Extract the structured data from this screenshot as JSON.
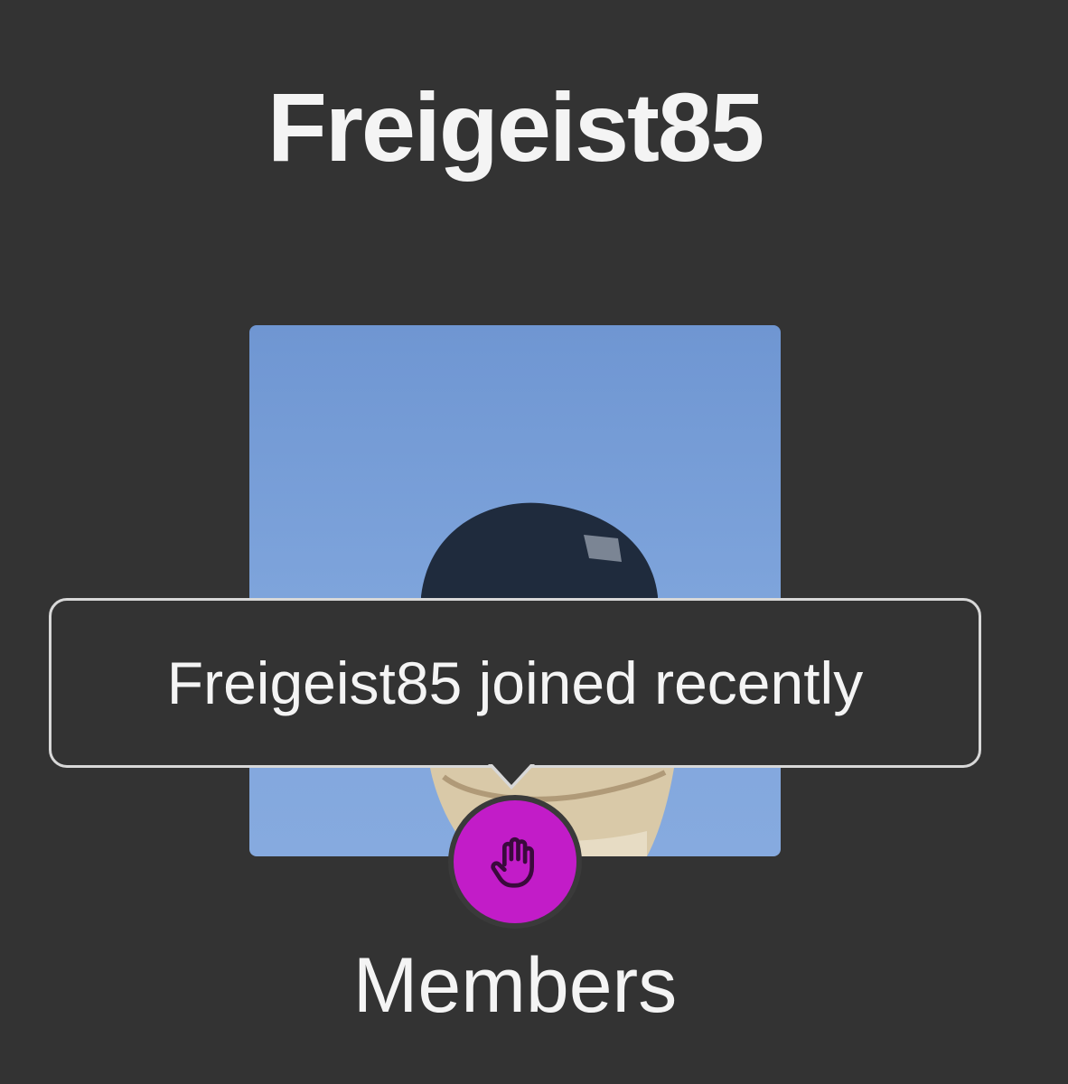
{
  "profile": {
    "username": "Freigeist85",
    "role_label": "Members",
    "badge_icon": "hand-icon",
    "badge_color": "#c21cc8"
  },
  "tooltip": {
    "text": "Freigeist85 joined recently"
  },
  "colors": {
    "background": "#333333",
    "text": "#f4f4f4",
    "tooltip_border": "#d8d8d8"
  }
}
